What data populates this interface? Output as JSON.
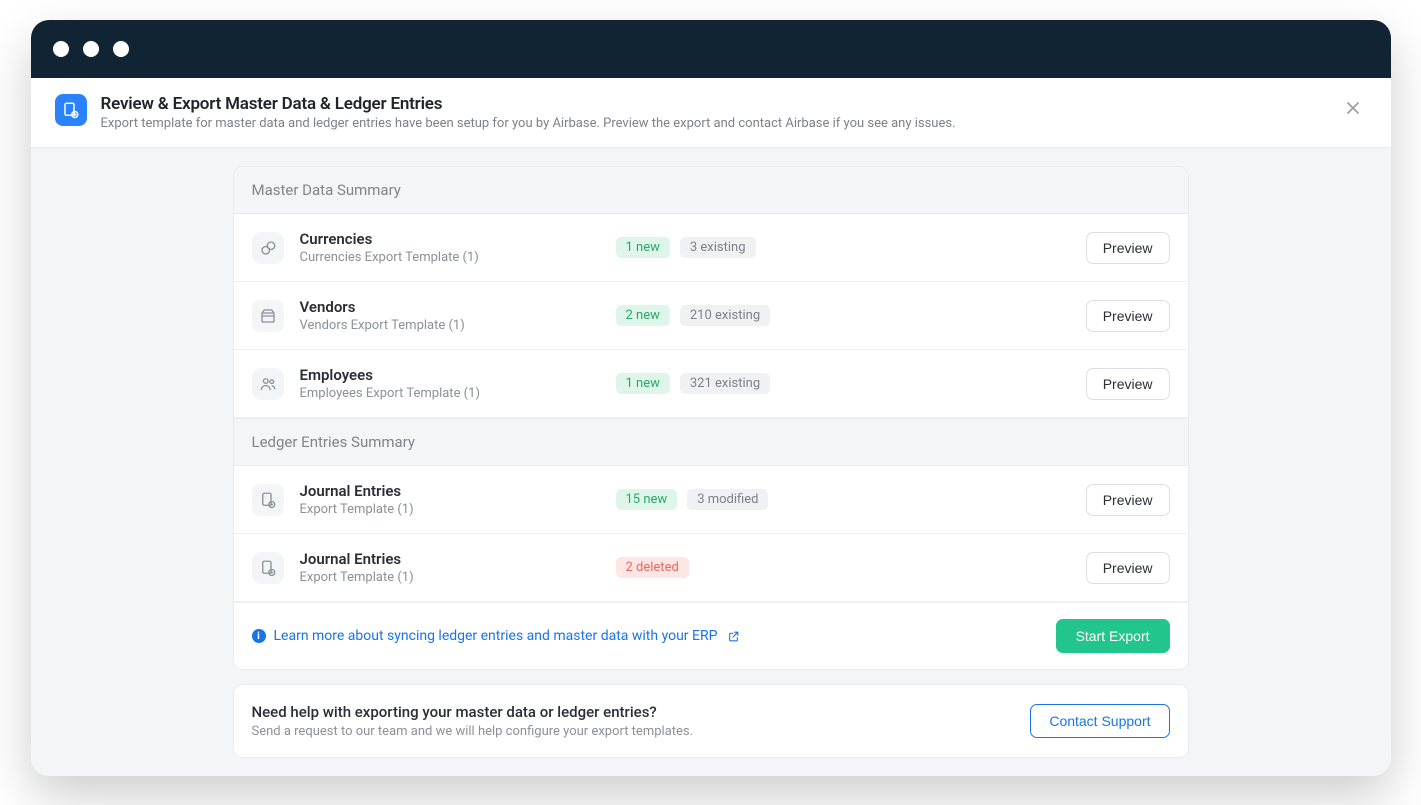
{
  "header": {
    "title": "Review & Export Master Data & Ledger Entries",
    "subtitle": "Export template for master data and ledger entries have been setup for you by Airbase. Preview the export and contact Airbase if you see any issues."
  },
  "sections": {
    "master": {
      "heading": "Master Data Summary",
      "rows": [
        {
          "title": "Currencies",
          "subtitle": "Currencies Export Template (1)",
          "badge1": "1 new",
          "badge2": "3 existing",
          "preview": "Preview"
        },
        {
          "title": "Vendors",
          "subtitle": "Vendors Export Template (1)",
          "badge1": "2 new",
          "badge2": "210 existing",
          "preview": "Preview"
        },
        {
          "title": "Employees",
          "subtitle": "Employees Export Template (1)",
          "badge1": "1 new",
          "badge2": "321 existing",
          "preview": "Preview"
        }
      ]
    },
    "ledger": {
      "heading": "Ledger Entries Summary",
      "rows": [
        {
          "title": "Journal Entries",
          "subtitle": "Export Template (1)",
          "badge1": "15 new",
          "badge2": "3 modified",
          "preview": "Preview"
        },
        {
          "title": "Journal Entries",
          "subtitle": "Export Template (1)",
          "badge1": "2 deleted",
          "preview": "Preview"
        }
      ]
    }
  },
  "footer": {
    "learn_more": "Learn more about syncing ledger entries and master data with your ERP",
    "start_export": "Start Export"
  },
  "help": {
    "title": "Need help with exporting your master data or ledger entries?",
    "subtitle": "Send a request to our team and we will help configure your export templates.",
    "contact": "Contact Support"
  }
}
